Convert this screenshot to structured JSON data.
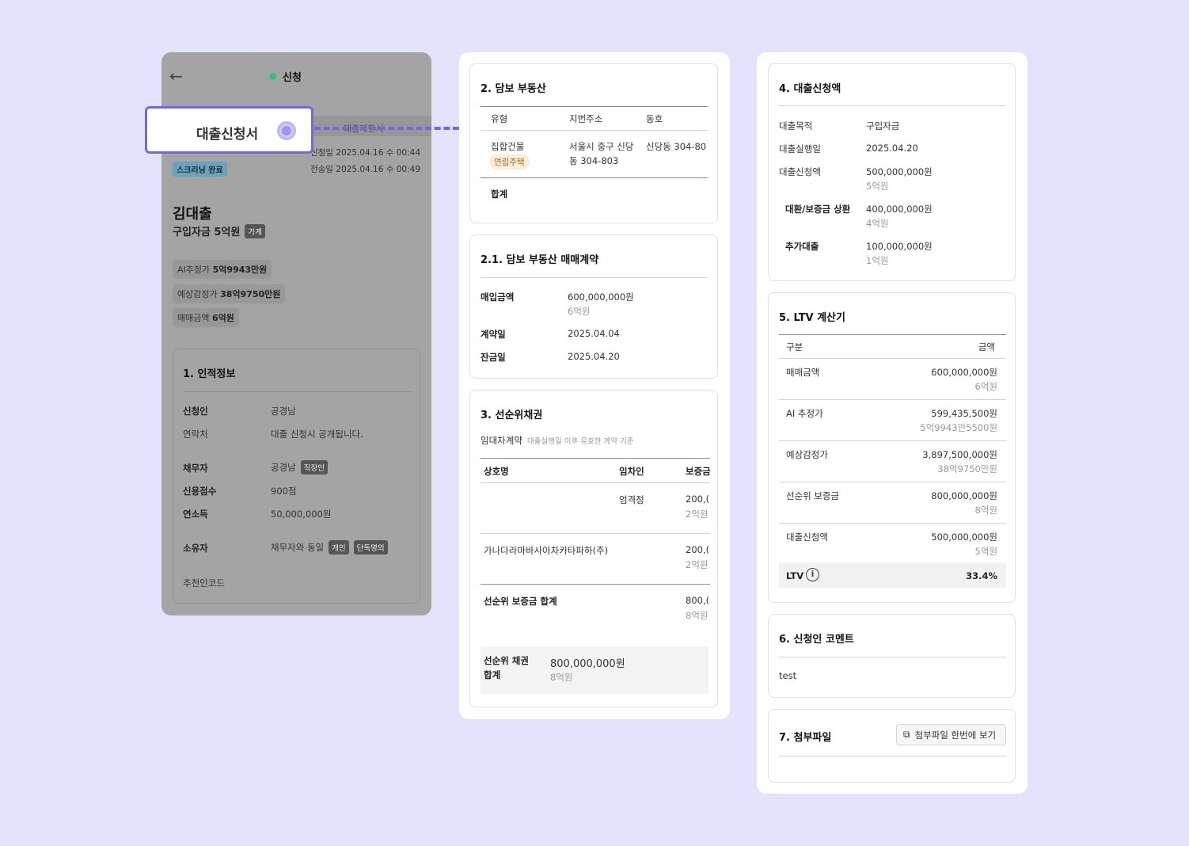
{
  "phone": {
    "title": "신청",
    "tab2": "대출제한서",
    "apply_date": "신청일 2025.04.16 수 00:44",
    "send_date": "전송일 2025.04.16 수 00:49",
    "screening": "스크리닝 완료",
    "name": "김대출",
    "purpose": "구입자금 5억원",
    "purpose_tag": "가계",
    "chips": [
      {
        "label": "AI추정가",
        "value": "5억9943만원"
      },
      {
        "label": "예상감정가",
        "value": "38억9750만원"
      },
      {
        "label": "매매금액",
        "value": "6억원"
      }
    ],
    "personal": {
      "title": "1. 인적정보",
      "applicant_label": "신청인",
      "applicant": "공경남",
      "contact_label": "연락처",
      "contact": "대출 신청시 공개됩니다.",
      "debtor_label": "채무자",
      "debtor": "공경남",
      "debtor_tag": "직장인",
      "credit_label": "신용점수",
      "credit": "900점",
      "income_label": "연소득",
      "income": "50,000,000원",
      "owner_label": "소유자",
      "owner": "채무자와 동일",
      "owner_tag1": "개인",
      "owner_tag2": "단독명의",
      "referral_label": "추천인코드"
    }
  },
  "callout": {
    "label": "대출신청서"
  },
  "collateral": {
    "title": "2. 담보 부동산",
    "cols": [
      "유형",
      "지번주소",
      "동호"
    ],
    "row": {
      "type": "집합건물",
      "type_tag": "연립주택",
      "addr1": "서울시 중구 신당",
      "addr2": "동 304-803",
      "unit": "신당동 304-80"
    },
    "total_label": "합계"
  },
  "contract": {
    "title": "2.1. 담보 부동산 매매계약",
    "purchase_label": "매입금액",
    "purchase": "600,000,000원",
    "purchase_sub": "6억원",
    "contract_label": "계약일",
    "contract_date": "2025.04.04",
    "balance_label": "잔금일",
    "balance_date": "2025.04.20"
  },
  "senior": {
    "title": "3. 선순위채권",
    "lease_label": "임대차계약",
    "lease_note": "대출실행일 이후 유효한 계약 기준",
    "cols": [
      "상호명",
      "임차인",
      "보증금"
    ],
    "rows": [
      {
        "company": "",
        "tenant": "엄격정",
        "amount": "200,(",
        "amount_sub": "2억원"
      },
      {
        "company": "가나다라마바사아차카타파하(주)",
        "tenant": "",
        "amount": "200,(",
        "amount_sub": "2억원"
      }
    ],
    "deposit_total_label": "선순위 보증금 합계",
    "deposit_total": "800,(",
    "deposit_total_sub": "8억원",
    "bond_total_label1": "선순위 채권",
    "bond_total_label2": "합계",
    "bond_total": "800,000,000원",
    "bond_total_sub": "8억원"
  },
  "loan": {
    "title": "4. 대출신청액",
    "purpose_label": "대출목적",
    "purpose": "구입자금",
    "exec_label": "대출실행일",
    "exec_date": "2025.04.20",
    "amount_label": "대출신청액",
    "amount": "500,000,000원",
    "amount_sub": "5억원",
    "refi_label": "대환/보증금 상환",
    "refi": "400,000,000원",
    "refi_sub": "4억원",
    "extra_label": "추가대출",
    "extra": "100,000,000원",
    "extra_sub": "1억원"
  },
  "ltv": {
    "title": "5. LTV 계산기",
    "col1": "구분",
    "col2": "금액",
    "rows": [
      {
        "label": "매매금액",
        "value": "600,000,000원",
        "sub": "6억원"
      },
      {
        "label": "AI 추정가",
        "value": "599,435,500원",
        "sub": "5억9943만5500원"
      },
      {
        "label": "예상감정가",
        "value": "3,897,500,000원",
        "sub": "38억9750만원"
      },
      {
        "label": "선순위 보증금",
        "value": "800,000,000원",
        "sub": "8억원"
      },
      {
        "label": "대출신청액",
        "value": "500,000,000원",
        "sub": "5억원"
      }
    ],
    "ltv_label": "LTV",
    "ltv_value": "33.4%"
  },
  "comment": {
    "title": "6. 신청인 코멘트",
    "text": "test"
  },
  "files": {
    "title": "7. 첨부파일",
    "button": "첨부파일 한번에 보기"
  }
}
